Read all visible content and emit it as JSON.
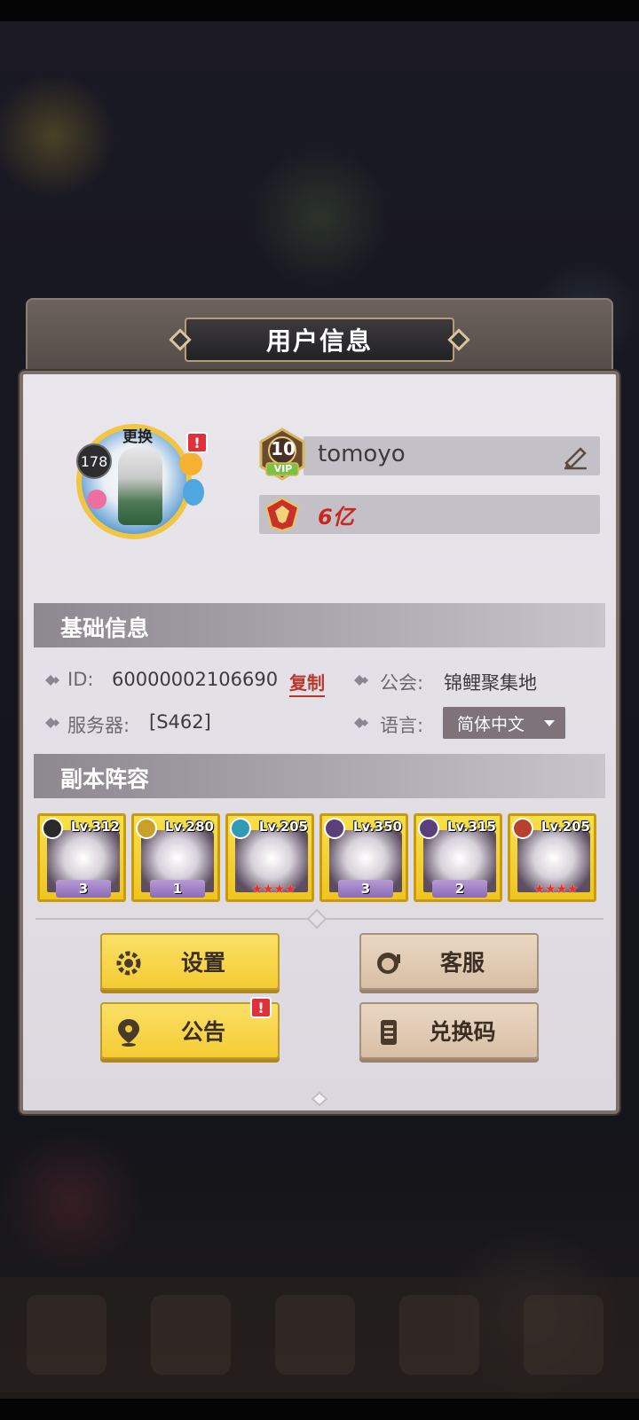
{
  "dialog": {
    "title": "用户信息"
  },
  "profile": {
    "avatar_level": "178",
    "change_label": "更换",
    "alert_mark": "!",
    "vip_level": "10",
    "vip_label": "VIP",
    "username": "tomoyo",
    "power": "6亿"
  },
  "basic_info": {
    "header": "基础信息",
    "id_label": "ID:",
    "id_value": "60000002106690",
    "copy_label": "复制",
    "guild_label": "公会:",
    "guild_value": "锦鲤聚集地",
    "server_label": "服务器:",
    "server_value": "[S462]",
    "language_label": "语言:",
    "language_value": "简体中文"
  },
  "lineup": {
    "header": "副本阵容",
    "heroes": [
      {
        "level": "Lv.312",
        "rank": "3",
        "element_color": "#2a2a2a"
      },
      {
        "level": "Lv.280",
        "rank": "1",
        "element_color": "#c9a12a"
      },
      {
        "level": "Lv.205",
        "rank": "★★★★",
        "element_color": "#2f9bb5"
      },
      {
        "level": "Lv.350",
        "rank": "3",
        "element_color": "#5b3f7a"
      },
      {
        "level": "Lv.315",
        "rank": "2",
        "element_color": "#5b3f7a"
      },
      {
        "level": "Lv.205",
        "rank": "★★★★",
        "element_color": "#b8402e"
      }
    ]
  },
  "buttons": {
    "settings": "设置",
    "support": "客服",
    "announcement": "公告",
    "redeem_code": "兑换码"
  },
  "colors": {
    "accent_yellow": "#f4cc34",
    "copy_red": "#b8392c",
    "power_red": "#c8281f"
  }
}
